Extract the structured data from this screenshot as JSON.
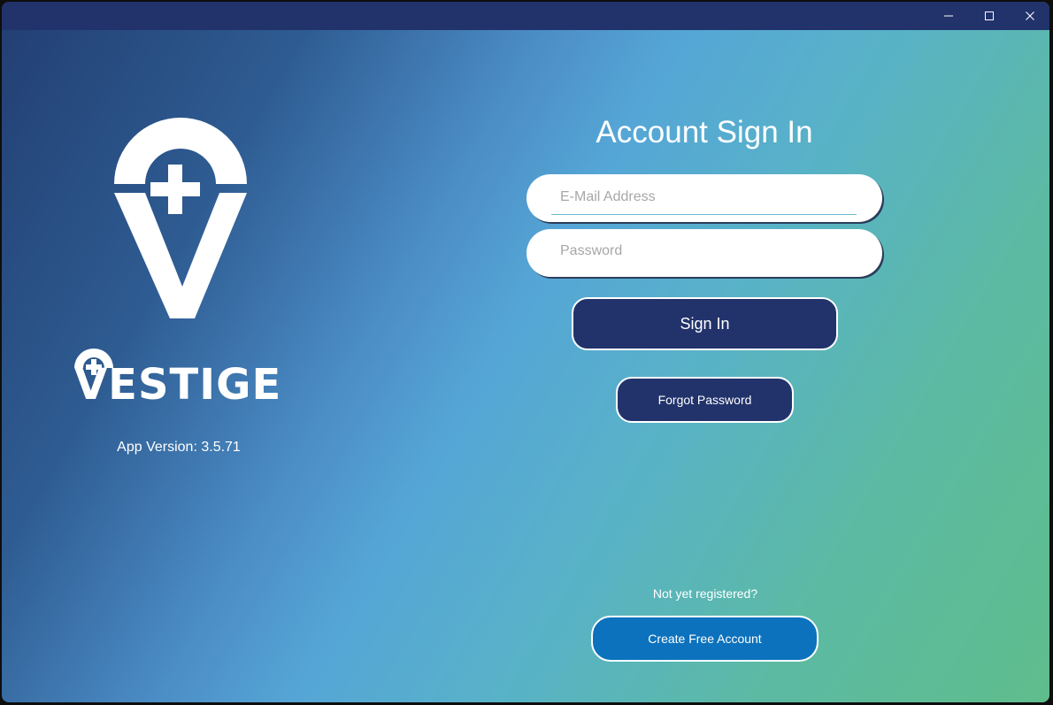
{
  "window": {
    "controls": {
      "minimize_icon": "minimize-icon",
      "maximize_icon": "maximize-icon",
      "close_icon": "close-icon"
    },
    "colors": {
      "titlebar": "#22336b",
      "primary_button": "#22336b",
      "create_button": "#0c72bd",
      "gradient_start": "#223e72",
      "gradient_end": "#5fbd8c"
    }
  },
  "brand": {
    "logo_icon": "location-pin-plus-icon",
    "wordmark": "VESTIGE",
    "version_label": "App Version:",
    "version_value": "3.5.71"
  },
  "signin": {
    "heading": "Account Sign In",
    "email_placeholder": "E-Mail Address",
    "email_value": "",
    "password_placeholder": "Password",
    "password_value": "",
    "signin_label": "Sign In",
    "forgot_label": "Forgot Password",
    "not_registered": "Not yet registered?",
    "create_label": "Create Free Account"
  }
}
